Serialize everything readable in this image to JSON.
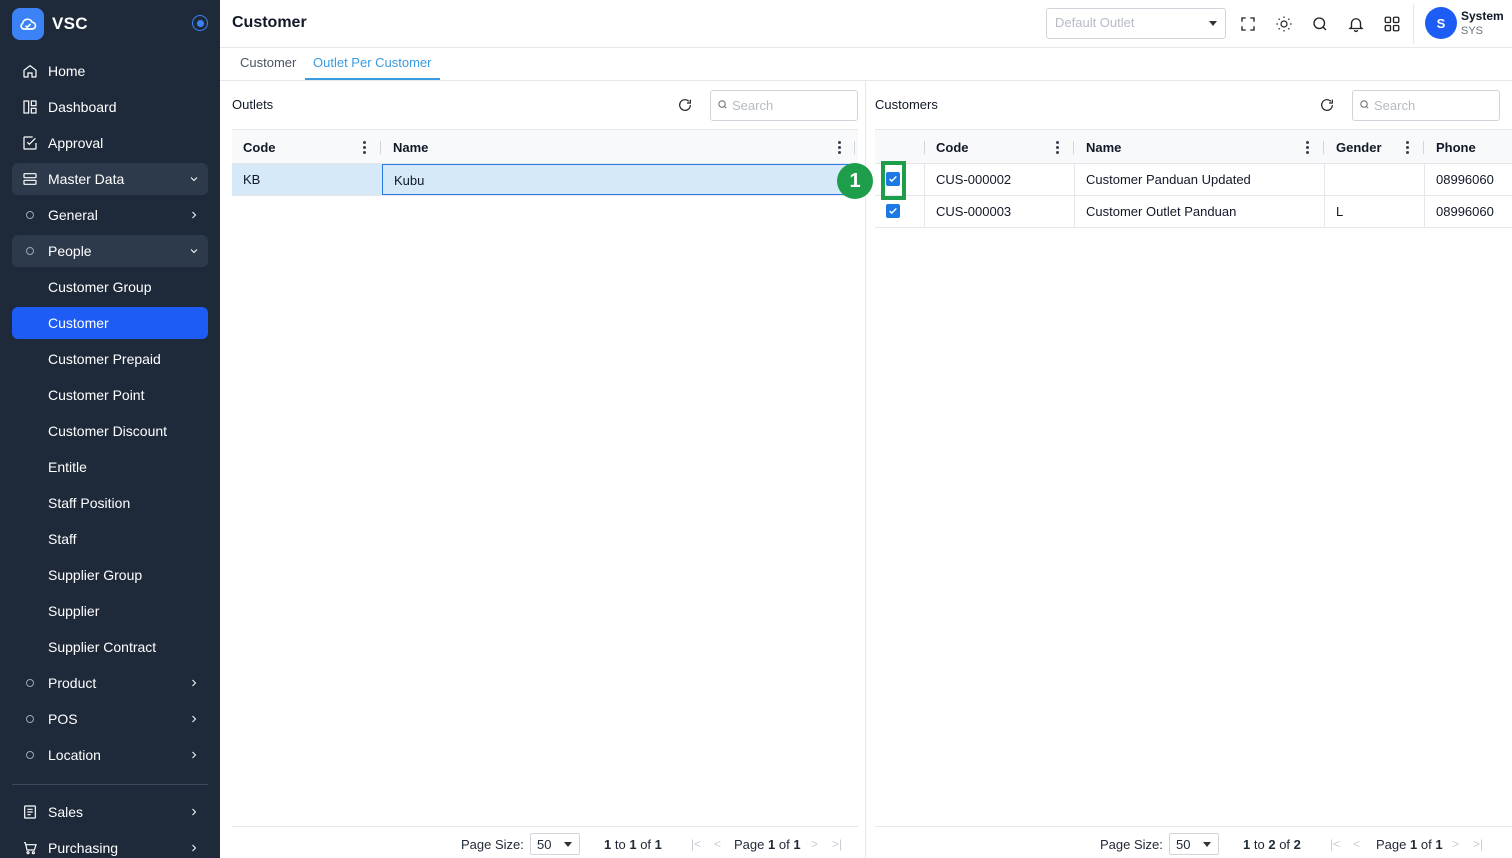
{
  "app": {
    "name": "VSC"
  },
  "sidebar": {
    "items": [
      {
        "label": "Home"
      },
      {
        "label": "Dashboard"
      },
      {
        "label": "Approval"
      },
      {
        "label": "Master Data"
      },
      {
        "label": "General"
      },
      {
        "label": "People"
      },
      {
        "label": "Customer Group"
      },
      {
        "label": "Customer"
      },
      {
        "label": "Customer Prepaid"
      },
      {
        "label": "Customer Point"
      },
      {
        "label": "Customer Discount"
      },
      {
        "label": "Entitle"
      },
      {
        "label": "Staff Position"
      },
      {
        "label": "Staff"
      },
      {
        "label": "Supplier Group"
      },
      {
        "label": "Supplier"
      },
      {
        "label": "Supplier Contract"
      },
      {
        "label": "Product"
      },
      {
        "label": "POS"
      },
      {
        "label": "Location"
      },
      {
        "label": "Sales"
      },
      {
        "label": "Purchasing"
      }
    ],
    "active_item": "Customer"
  },
  "header": {
    "title": "Customer",
    "outlet_placeholder": "Default Outlet",
    "user": {
      "name": "System",
      "code": "SYS",
      "initial": "S"
    }
  },
  "tabs": [
    {
      "label": "Customer"
    },
    {
      "label": "Outlet Per Customer"
    }
  ],
  "outlets": {
    "title": "Outlets",
    "search_placeholder": "Search",
    "columns": [
      "Code",
      "Name"
    ],
    "rows": [
      {
        "code": "KB",
        "name": "Kubu"
      }
    ],
    "footer": {
      "page_size_label": "Page Size:",
      "page_size": "50",
      "from": "1",
      "to_word": "to",
      "to": "1",
      "of_word": "of",
      "total": "1",
      "page_word": "Page",
      "page": "1",
      "pages": "1"
    }
  },
  "customers": {
    "title": "Customers",
    "search_placeholder": "Search",
    "columns": [
      "Code",
      "Name",
      "Gender",
      "Phone"
    ],
    "rows": [
      {
        "code": "CUS-000002",
        "name": "Customer Panduan Updated",
        "gender": "",
        "phone": "08996060",
        "checked": true
      },
      {
        "code": "CUS-000003",
        "name": "Customer Outlet Panduan",
        "gender": "L",
        "phone": "08996060",
        "checked": true
      }
    ],
    "footer": {
      "page_size_label": "Page Size:",
      "page_size": "50",
      "from": "1",
      "to_word": "to",
      "to": "2",
      "of_word": "of",
      "total": "2",
      "page_word": "Page",
      "page": "1",
      "pages": "1"
    }
  },
  "annotation": {
    "step": "1"
  },
  "colors": {
    "sidebar_bg": "#1e2a3a",
    "active": "#1d5cf5",
    "tab_active": "#3b9be0",
    "annotation": "#1e9e4a",
    "selected_row": "#d6e9f8"
  }
}
